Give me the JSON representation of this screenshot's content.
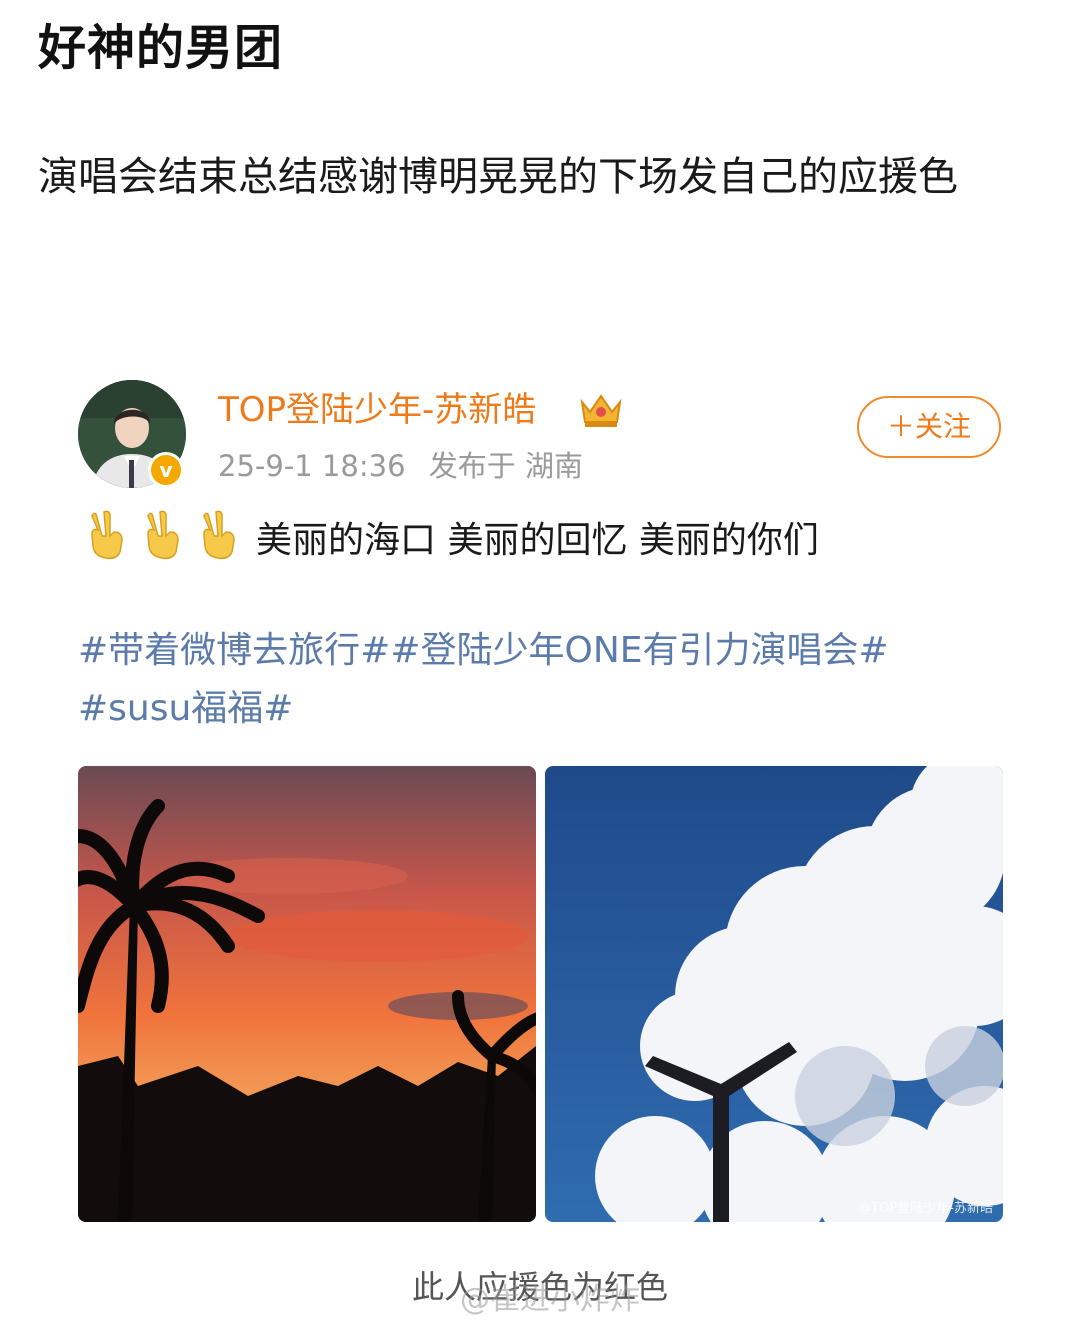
{
  "page": {
    "title": "好神的男团",
    "body": "演唱会结束总结感谢博明晃晃的下场发自己的应援色"
  },
  "card": {
    "username": "TOP登陆少年-苏新皓",
    "crown_icon": "crown-badge-icon",
    "verified_icon": "verified-v-icon",
    "timestamp": "25-9-1 18:36",
    "location": "发布于 湖南",
    "follow_label": "＋关注",
    "text": "美丽的海口 美丽的回忆 美丽的你们",
    "emoji_icon": "victory-hand-icon",
    "topics": [
      "#带着微博去旅行#",
      "#登陆少年ONE有引力演唱会#",
      "#susu福福#"
    ],
    "photo_left": "sunset-palm-tree-photo",
    "photo_right": "blue-sky-clouds-photo",
    "photo_watermark": "@TOP登陆少年-苏新皓"
  },
  "footer": {
    "caption": "此人应援色为红色",
    "watermark": "@崔进小炸炸"
  },
  "colors": {
    "accent_orange": "#ef7a1a",
    "topic_blue": "#5b7bab",
    "meta_gray": "#9a9a9a"
  }
}
